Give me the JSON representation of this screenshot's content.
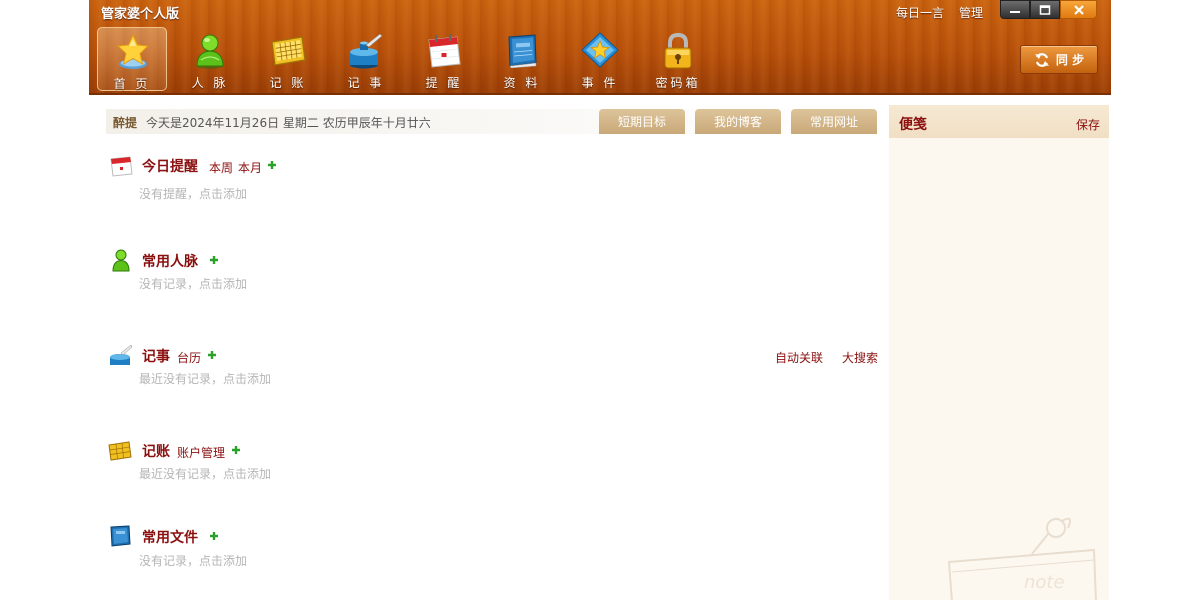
{
  "window": {
    "title": "管家婆个人版",
    "links": [
      "每日一言",
      "管理"
    ],
    "controls": {
      "minimize": "▬",
      "maximize": "▭",
      "close": "✕"
    }
  },
  "toolbar": {
    "items": [
      {
        "label": "首 页",
        "icon": "star-icon",
        "active": true
      },
      {
        "label": "人 脉",
        "icon": "contact-person-icon",
        "active": false
      },
      {
        "label": "记 账",
        "icon": "calculator-icon",
        "active": false
      },
      {
        "label": "记 事",
        "icon": "inkwell-icon",
        "active": false
      },
      {
        "label": "提 醒",
        "icon": "calendar-icon",
        "active": false
      },
      {
        "label": "资 料",
        "icon": "book-icon",
        "active": false
      },
      {
        "label": "事 件",
        "icon": "event-star-icon",
        "active": false
      },
      {
        "label": "密码箱",
        "icon": "lock-icon",
        "active": false
      }
    ],
    "sync_label": "同 步"
  },
  "tipbar": {
    "heading": "醉提",
    "text": "今天是2024年11月26日  星期二  农历甲辰年十月廿六"
  },
  "tabs": [
    "短期目标",
    "我的博客",
    "常用网址"
  ],
  "sections": {
    "reminder": {
      "title": "今日提醒",
      "links": [
        "本周",
        "本月"
      ],
      "empty": "没有提醒，点击添加"
    },
    "contacts": {
      "title": "常用人脉",
      "empty": "没有记录，点击添加"
    },
    "notes": {
      "title": "记事",
      "link": "台历",
      "right_links": [
        "自动关联",
        "大搜索"
      ],
      "empty": "最近没有记录，点击添加"
    },
    "accounts": {
      "title": "记账",
      "link": "账户管理",
      "empty": "最近没有记录，点击添加"
    },
    "files": {
      "title": "常用文件",
      "empty": "没有记录，点击添加"
    }
  },
  "note_panel": {
    "title": "便笺",
    "save": "保存",
    "decoration_text": "note"
  },
  "colors": {
    "header": "#b8500a",
    "title_red": "#8a1010",
    "tab": "#d3b688",
    "note_bg": "#fdf8ef"
  }
}
